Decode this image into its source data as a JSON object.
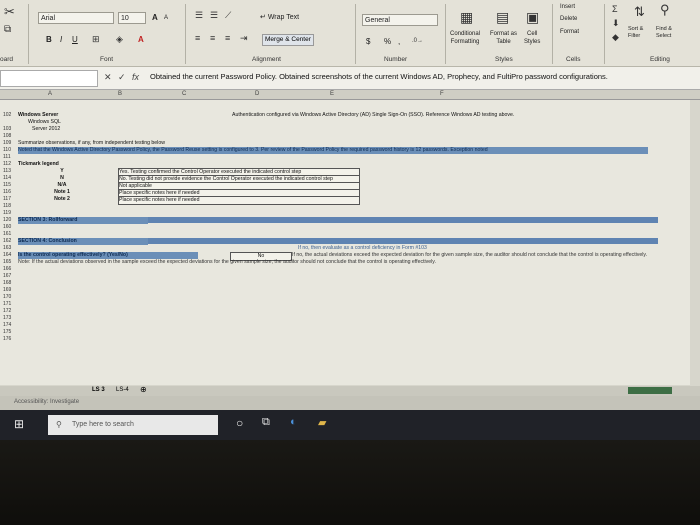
{
  "ribbon": {
    "font_name": "Arial",
    "font_size": "10",
    "bold": "B",
    "italic": "I",
    "underline": "U",
    "grow_font": "A",
    "shrink_font": "A",
    "wrap_text": "Wrap Text",
    "merge_center": "Merge & Center",
    "number_format": "General",
    "currency": "$",
    "percent": "%",
    "comma": ",",
    "conditional_formatting_1": "Conditional",
    "conditional_formatting_2": "Formatting",
    "format_as_table_1": "Format as",
    "format_as_table_2": "Table",
    "cell_styles_1": "Cell",
    "cell_styles_2": "Styles",
    "insert": "Insert",
    "delete": "Delete",
    "format": "Format",
    "sort_filter_1": "Sort &",
    "sort_filter_2": "Filter",
    "find_select_1": "Find &",
    "find_select_2": "Select",
    "groups": {
      "clipboard": "oard",
      "font": "Font",
      "alignment": "Alignment",
      "number": "Number",
      "styles": "Styles",
      "cells": "Cells",
      "editing": "Editing"
    }
  },
  "formula_bar": {
    "fx": "fx",
    "cancel": "✕",
    "confirm": "✓",
    "content": "Obtained the current Password Policy. Obtained screenshots of the current Windows AD, Prophecy, and FultiPro password configurations."
  },
  "columns": [
    "A",
    "B",
    "C",
    "D",
    "E",
    "F"
  ],
  "rows": [
    {
      "n": "102",
      "a": "Windows Server",
      "c": "Authentication configured via Windows Active Directory (AD) Single Sign-On (SSO). Reference Windows AD testing above."
    },
    {
      "n": "",
      "a": "Windows SQL",
      "c": ""
    },
    {
      "n": "103",
      "a": "Server 2012",
      "c": ""
    },
    {
      "n": "108",
      "a": "",
      "c": ""
    },
    {
      "n": "109",
      "a": "Summarize observations, if any, from independent testing below",
      "c": ""
    },
    {
      "n": "110",
      "a": "Noted that the Windows Active Directory Password Policy, the Password Reuse setting is configured to 3. Per review of the Password Policy the required password history is 12 passwords. Exception noted",
      "c": ""
    },
    {
      "n": "111",
      "a": "",
      "c": ""
    },
    {
      "n": "112",
      "a": "Tickmark legend",
      "c": ""
    },
    {
      "n": "113",
      "a": "Y",
      "c": "Yes. Testing confirmed the Control Operator executed the indicated control step"
    },
    {
      "n": "114",
      "a": "N",
      "c": "No. Testing did not provide evidence the Control Operator executed the indicated control step"
    },
    {
      "n": "115",
      "a": "N/A",
      "c": "Not applicable"
    },
    {
      "n": "116",
      "a": "Note 1",
      "c": "Place specific notes here if needed"
    },
    {
      "n": "117",
      "a": "Note 2",
      "c": "Place specific notes here if needed"
    },
    {
      "n": "118",
      "a": "",
      "c": ""
    },
    {
      "n": "119",
      "a": "",
      "c": ""
    },
    {
      "n": "120",
      "a": "SECTION 3: Rollforward",
      "c": ""
    },
    {
      "n": "160",
      "a": "",
      "c": ""
    },
    {
      "n": "161",
      "a": "",
      "c": ""
    },
    {
      "n": "162",
      "a": "SECTION 4: Conclusion",
      "c": ""
    },
    {
      "n": "163",
      "a": "",
      "c": "If no, then evaluate as a control deficiency in Form #103"
    },
    {
      "n": "164",
      "a": "Is the control operating effectively? (Yes/No)",
      "c": "No",
      "d": "If no, the actual deviations exceed the expected deviation for the given sample size, the auditor should not conclude that the control is operating effectively."
    },
    {
      "n": "165",
      "a": "Note: If the actual deviations observed in the sample exceed the expected deviations for the given sample size, the auditor should not conclude that the control is operating effectively.",
      "c": ""
    },
    {
      "n": "166",
      "a": "",
      "c": ""
    },
    {
      "n": "167",
      "a": "",
      "c": ""
    },
    {
      "n": "168",
      "a": "",
      "c": ""
    },
    {
      "n": "169",
      "a": "",
      "c": ""
    },
    {
      "n": "170",
      "a": "",
      "c": ""
    },
    {
      "n": "171",
      "a": "",
      "c": ""
    },
    {
      "n": "172",
      "a": "",
      "c": ""
    },
    {
      "n": "173",
      "a": "",
      "c": ""
    },
    {
      "n": "174",
      "a": "",
      "c": ""
    },
    {
      "n": "175",
      "a": "",
      "c": ""
    },
    {
      "n": "176",
      "a": "",
      "c": ""
    }
  ],
  "sheet_tabs": [
    "LS 3",
    "LS-4"
  ],
  "status": {
    "accessibility": "Accessibility: Investigate"
  },
  "taskbar": {
    "search_placeholder": "Type here to search"
  }
}
